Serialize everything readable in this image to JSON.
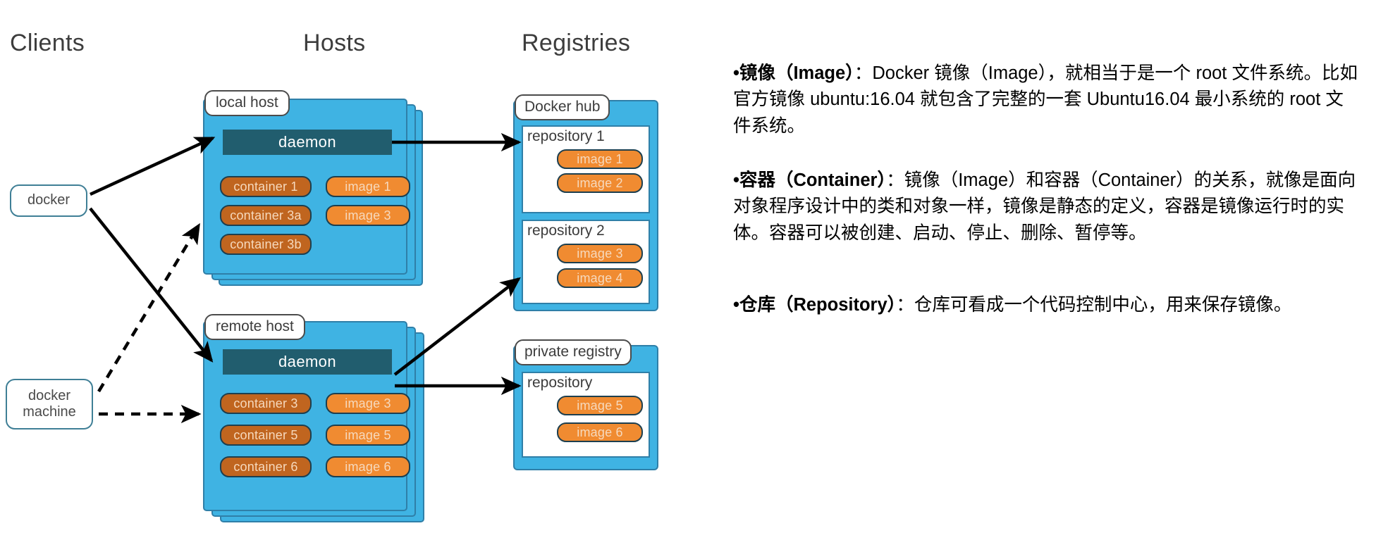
{
  "headings": {
    "clients": "Clients",
    "hosts": "Hosts",
    "registries": "Registries"
  },
  "clients": [
    {
      "id": "docker",
      "label": "docker"
    },
    {
      "id": "docker-machine",
      "line1": "docker",
      "line2": "machine"
    }
  ],
  "hosts": [
    {
      "id": "local-host",
      "tab": "local host",
      "daemon": "daemon",
      "containers": [
        "container 1",
        "container 3a",
        "container 3b"
      ],
      "images": [
        "image 1",
        "image 3"
      ]
    },
    {
      "id": "remote-host",
      "tab": "remote host",
      "daemon": "daemon",
      "containers": [
        "container 3",
        "container 5",
        "container 6"
      ],
      "images": [
        "image 3",
        "image 5",
        "image 6"
      ]
    }
  ],
  "registries": [
    {
      "id": "docker-hub",
      "tab": "Docker hub",
      "repositories": [
        {
          "label": "repository 1",
          "images": [
            "image 1",
            "image 2"
          ]
        },
        {
          "label": "repository 2",
          "images": [
            "image 3",
            "image 4"
          ]
        }
      ]
    },
    {
      "id": "private-registry",
      "tab": "private registry",
      "repositories": [
        {
          "label": "repository",
          "images": [
            "image 5",
            "image 6"
          ]
        }
      ]
    }
  ],
  "colors": {
    "host_blue": "#3fb3e3",
    "host_border": "#2f7fa8",
    "daemon_teal": "#215d6e",
    "container_orange": "#c0651f",
    "image_orange": "#f08b31",
    "client_border": "#3f7f96",
    "arrow_black": "#000000"
  },
  "notes": [
    {
      "id": "image",
      "bullet": "•",
      "lead": "镜像（Image）",
      "body": "：Docker 镜像（Image），就相当于是一个 root 文件系统。比如官方镜像 ubuntu:16.04 就包含了完整的一套 Ubuntu16.04 最小系统的 root 文件系统。"
    },
    {
      "id": "container",
      "bullet": "•",
      "lead": "容器（Container）",
      "body": "：镜像（Image）和容器（Container）的关系，就像是面向对象程序设计中的类和对象一样，镜像是静态的定义，容器是镜像运行时的实体。容器可以被创建、启动、停止、删除、暂停等。"
    },
    {
      "id": "repository",
      "bullet": "•",
      "lead": "仓库（Repository）",
      "body": "：仓库可看成一个代码控制中心，用来保存镜像。"
    }
  ]
}
